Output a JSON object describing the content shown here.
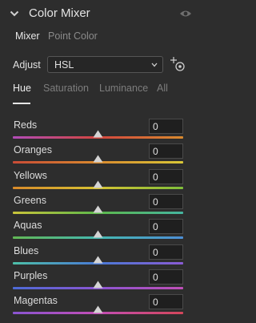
{
  "header": {
    "title": "Color Mixer"
  },
  "subtabs": [
    "Mixer",
    "Point Color"
  ],
  "adjust": {
    "label": "Adjust",
    "value": "HSL"
  },
  "mode_tabs": [
    "Hue",
    "Saturation",
    "Luminance",
    "All"
  ],
  "rows": [
    {
      "label": "Reds",
      "value": "0",
      "slider": 0.5,
      "gradient": [
        "#b24cb8",
        "#d4463f",
        "#d98a2e"
      ]
    },
    {
      "label": "Oranges",
      "value": "0",
      "slider": 0.5,
      "gradient": [
        "#c94c36",
        "#d98a2e",
        "#d9c737"
      ]
    },
    {
      "label": "Yellows",
      "value": "0",
      "slider": 0.5,
      "gradient": [
        "#d98b2a",
        "#d6c233",
        "#7fbf3a"
      ]
    },
    {
      "label": "Greens",
      "value": "0",
      "slider": 0.5,
      "gradient": [
        "#c9c43a",
        "#5db84b",
        "#45b5a0"
      ]
    },
    {
      "label": "Aquas",
      "value": "0",
      "slider": 0.5,
      "gradient": [
        "#62b855",
        "#45b8b0",
        "#4d8fd6"
      ]
    },
    {
      "label": "Blues",
      "value": "0",
      "slider": 0.5,
      "gradient": [
        "#4dbfa8",
        "#4a7ad6",
        "#8a5bd4"
      ]
    },
    {
      "label": "Purples",
      "value": "0",
      "slider": 0.5,
      "gradient": [
        "#4d6bd6",
        "#8a55d2",
        "#c04fb8"
      ]
    },
    {
      "label": "Magentas",
      "value": "0",
      "slider": 0.5,
      "gradient": [
        "#8a55d2",
        "#c24eb5",
        "#d4465a"
      ]
    }
  ]
}
